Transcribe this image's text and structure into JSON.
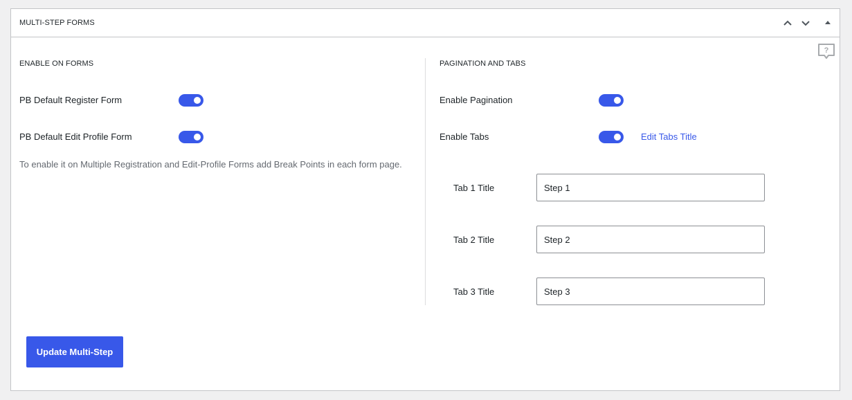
{
  "panel": {
    "title": "MULTI-STEP FORMS",
    "header_icons": [
      "chevron-up-icon",
      "chevron-down-icon",
      "triangle-up-icon"
    ],
    "help_icon": "help-speech-bubble-icon"
  },
  "left": {
    "section_title": "ENABLE ON FORMS",
    "fields": [
      {
        "label": "PB Default Register Form",
        "enabled": true
      },
      {
        "label": "PB Default Edit Profile Form",
        "enabled": true
      }
    ],
    "hint": "To enable it on Multiple Registration and Edit-Profile Forms add Break Points in each form page."
  },
  "right": {
    "section_title": "PAGINATION AND TABS",
    "fields": [
      {
        "label": "Enable Pagination",
        "enabled": true
      },
      {
        "label": "Enable Tabs",
        "enabled": true
      }
    ],
    "edit_tabs_link": "Edit Tabs Title",
    "tabs": [
      {
        "label": "Tab 1 Title",
        "value": "Step 1"
      },
      {
        "label": "Tab 2 Title",
        "value": "Step 2"
      },
      {
        "label": "Tab 3 Title",
        "value": "Step 3"
      }
    ]
  },
  "update_button": "Update Multi-Step",
  "colors": {
    "accent": "#3858e9",
    "border": "#c3c4c7",
    "background": "#f0f0f1"
  }
}
